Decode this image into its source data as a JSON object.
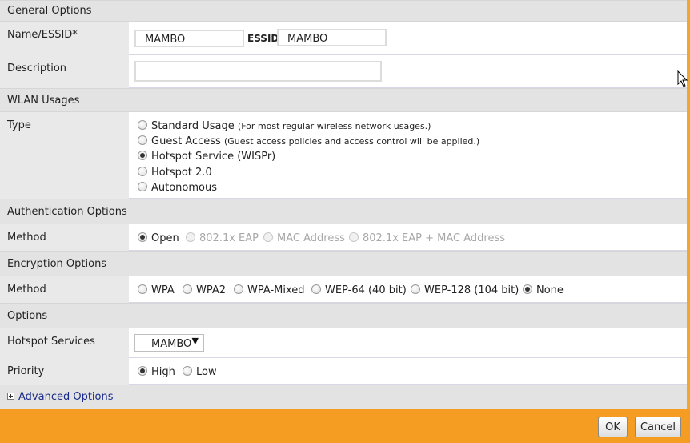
{
  "sections": {
    "general": "General Options",
    "wlan": "WLAN Usages",
    "auth": "Authentication Options",
    "encryption": "Encryption Options",
    "options": "Options"
  },
  "general": {
    "name_label": "Name/ESSID*",
    "name_value": "MAMBO",
    "essid_label": "ESSID",
    "essid_value": "MAMBO",
    "description_label": "Description",
    "description_value": ""
  },
  "wlan": {
    "type_label": "Type",
    "types": [
      {
        "label": "Standard Usage",
        "note": "(For most regular wireless network usages.)",
        "checked": false
      },
      {
        "label": "Guest Access",
        "note": "(Guest access policies and access control will be applied.)",
        "checked": false
      },
      {
        "label": "Hotspot Service (WISPr)",
        "note": "",
        "checked": true
      },
      {
        "label": "Hotspot 2.0",
        "note": "",
        "checked": false
      },
      {
        "label": "Autonomous",
        "note": "",
        "checked": false
      }
    ]
  },
  "auth": {
    "method_label": "Method",
    "methods": [
      {
        "label": "Open",
        "checked": true,
        "disabled": false
      },
      {
        "label": "802.1x EAP",
        "checked": false,
        "disabled": true
      },
      {
        "label": "MAC Address",
        "checked": false,
        "disabled": true
      },
      {
        "label": "802.1x EAP + MAC Address",
        "checked": false,
        "disabled": true
      }
    ]
  },
  "encryption": {
    "method_label": "Method",
    "methods": [
      {
        "label": "WPA",
        "checked": false
      },
      {
        "label": "WPA2",
        "checked": false
      },
      {
        "label": "WPA-Mixed",
        "checked": false
      },
      {
        "label": "WEP-64 (40 bit)",
        "checked": false
      },
      {
        "label": "WEP-128 (104 bit)",
        "checked": false
      },
      {
        "label": "None",
        "checked": true
      }
    ]
  },
  "options": {
    "hotspot_label": "Hotspot Services",
    "hotspot_value": "MAMBO",
    "priority_label": "Priority",
    "priorities": [
      {
        "label": "High",
        "checked": true
      },
      {
        "label": "Low",
        "checked": false
      }
    ]
  },
  "advanced_label": "Advanced Options",
  "buttons": {
    "ok": "OK",
    "cancel": "Cancel"
  },
  "colors": {
    "footer": "#f49d22",
    "link": "#1a2b8a",
    "section_bg": "#e3e3e3"
  }
}
